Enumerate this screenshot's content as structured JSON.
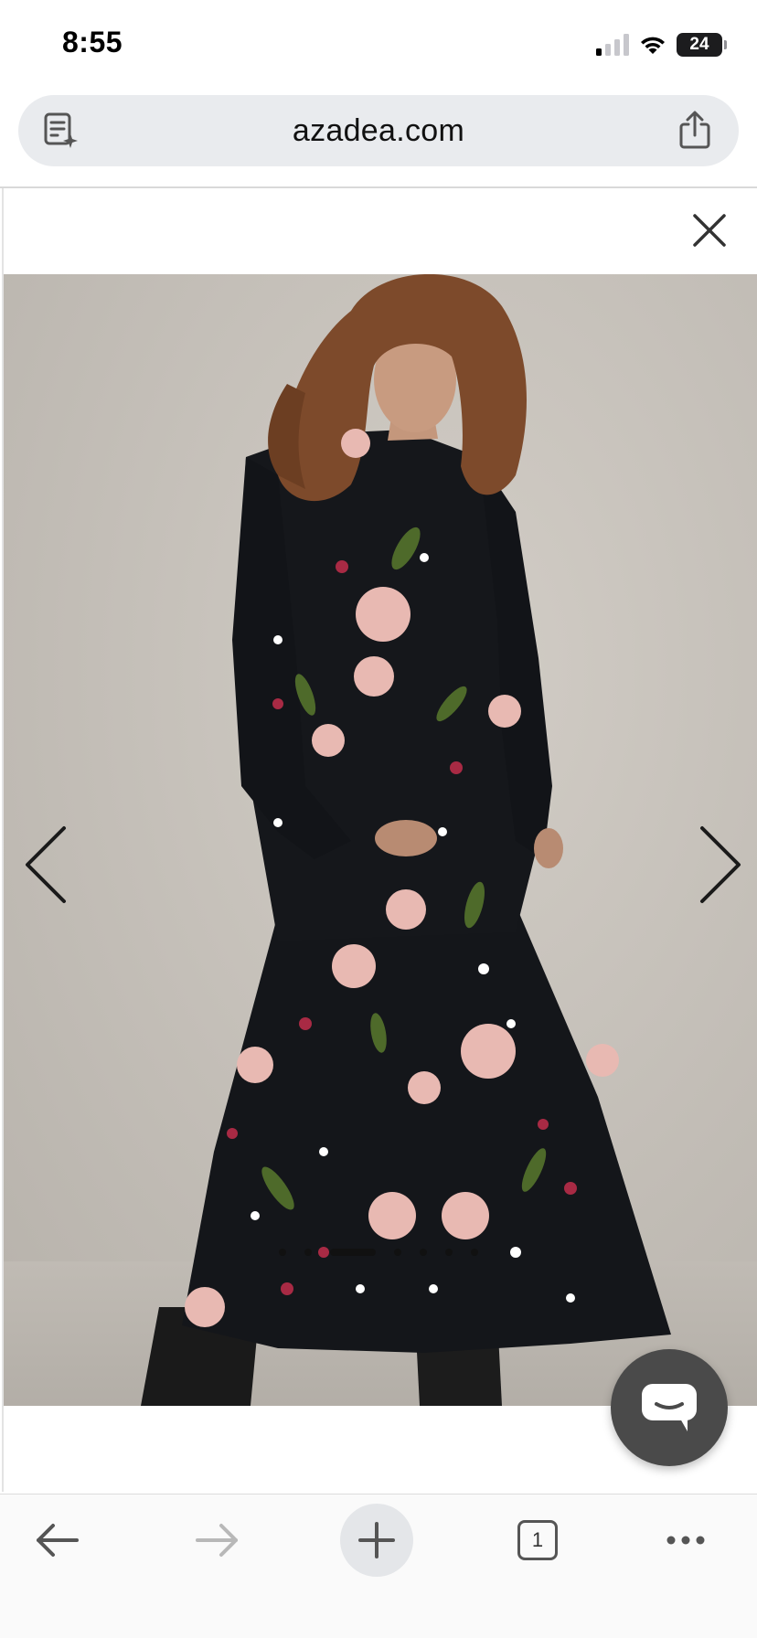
{
  "status_bar": {
    "time": "8:55",
    "battery_level": "24",
    "signal_bars_active": 1,
    "signal_bars_total": 4,
    "icons": [
      "signal-icon",
      "wifi-icon",
      "battery-icon"
    ]
  },
  "browser": {
    "url": "azadea.com",
    "reader_icon": "reader-mode-icon",
    "share_icon": "share-icon"
  },
  "gallery": {
    "close_icon": "close-icon",
    "prev_icon": "chevron-left-icon",
    "next_icon": "chevron-right-icon",
    "image_alt": "Floral print tiered shirt dress",
    "slide_count": 7,
    "active_slide": 3
  },
  "chat": {
    "icon": "chat-bubble-icon"
  },
  "toolbar": {
    "back_icon": "back-arrow-icon",
    "forward_icon": "forward-arrow-icon",
    "new_tab_icon": "plus-icon",
    "tabs_count": "1",
    "more_icon": "more-icon"
  },
  "colors": {
    "address_bar_bg": "#e9ebee",
    "chat_button_bg": "#4a4a4a",
    "dress_black": "#14161a",
    "backdrop": "#c7c2bb"
  }
}
